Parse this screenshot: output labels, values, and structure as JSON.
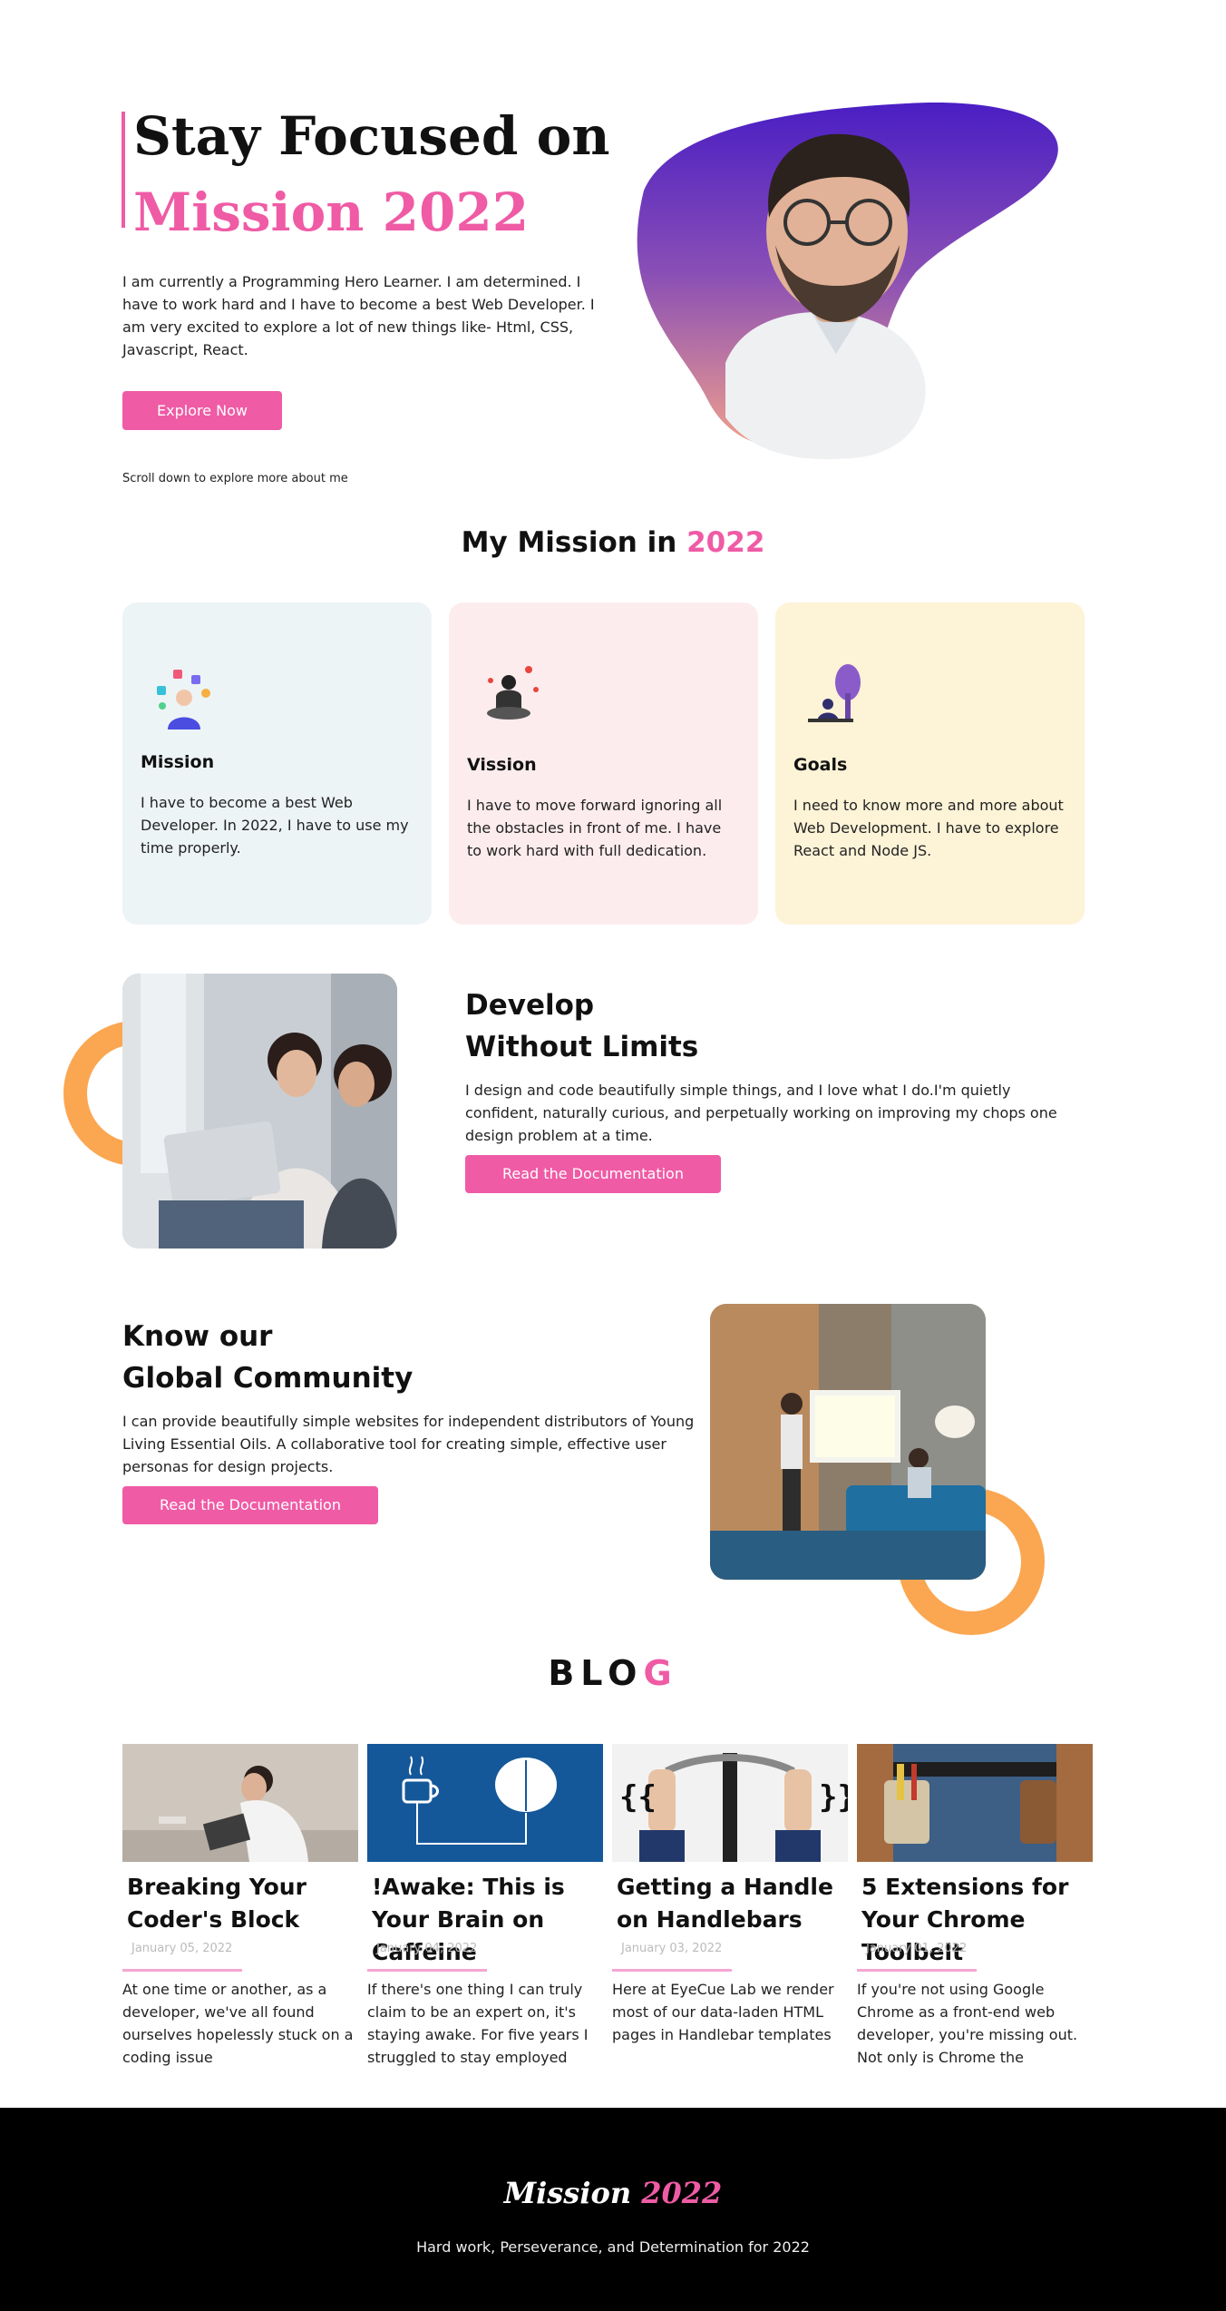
{
  "hero": {
    "title_line1": "Stay Focused on",
    "title_line2": "Mission 2022",
    "description": "I am currently a Programming Hero Learner. I am determined. I have to work hard and I have to become a best Web Developer. I am very excited to explore a lot of new things like- Html, CSS, Javascript, React.",
    "button_label": "Explore Now",
    "scroll_note": "Scroll down to explore more about me"
  },
  "mission": {
    "heading_text": "My Mission in",
    "heading_year": "2022",
    "cards": [
      {
        "title": "Mission",
        "text": "I have to become a best Web Developer. In 2022, I have to use my time properly."
      },
      {
        "title": "Vission",
        "text": "I have to move forward ignoring all the obstacles in front of me. I have to work hard with full dedication."
      },
      {
        "title": "Goals",
        "text": "I need to know more and more about Web Development. I have to explore React and Node JS."
      }
    ]
  },
  "develop": {
    "title_line1": "Develop",
    "title_line2": "Without Limits",
    "text": "I design and code beautifully simple things, and I love what I do.I'm quietly confident, naturally curious, and perpetually working on improving my chops one design problem at a time.",
    "button_label": "Read the Documentation"
  },
  "community": {
    "title_line1": "Know our",
    "title_line2": "Global Community",
    "text": "I can provide beautifully simple websites for independent distributors of Young Living Essential Oils. A collaborative tool for creating simple, effective user personas for design projects.",
    "button_label": "Read the Documentation"
  },
  "blog": {
    "heading_main": "BLO",
    "heading_accent": "G",
    "posts": [
      {
        "title": "Breaking Your Coder's Block",
        "date": "January 05, 2022",
        "text": "At one time or another, as a developer, we've all found ourselves hopelessly stuck on a coding issue"
      },
      {
        "title": "!Awake: This is Your Brain on Caffeine",
        "date": "January 04, 2022",
        "text": "If there's one thing I can truly claim to be an expert on, it's staying awake. For five years I struggled to stay employed"
      },
      {
        "title": "Getting a Handle on Handlebars",
        "date": "January 03, 2022",
        "text": "Here at EyeCue Lab we render most of our data-laden HTML pages in Handlebar templates"
      },
      {
        "title": "5 Extensions for Your Chrome Toolbelt",
        "date": "January 01, 2022",
        "text": "If you're not using Google Chrome as a front-end web developer, you're missing out. Not only is Chrome the"
      }
    ]
  },
  "footer": {
    "logo_main": "Mission",
    "logo_accent": "2022",
    "tagline": "Hard work, Perseverance, and Determination for 2022"
  },
  "colors": {
    "accent": "#ef5ba5",
    "orange": "#fba651",
    "card_mission": "#edf4f6",
    "card_vission": "#fdecee",
    "card_goals": "#fdf3d7"
  }
}
